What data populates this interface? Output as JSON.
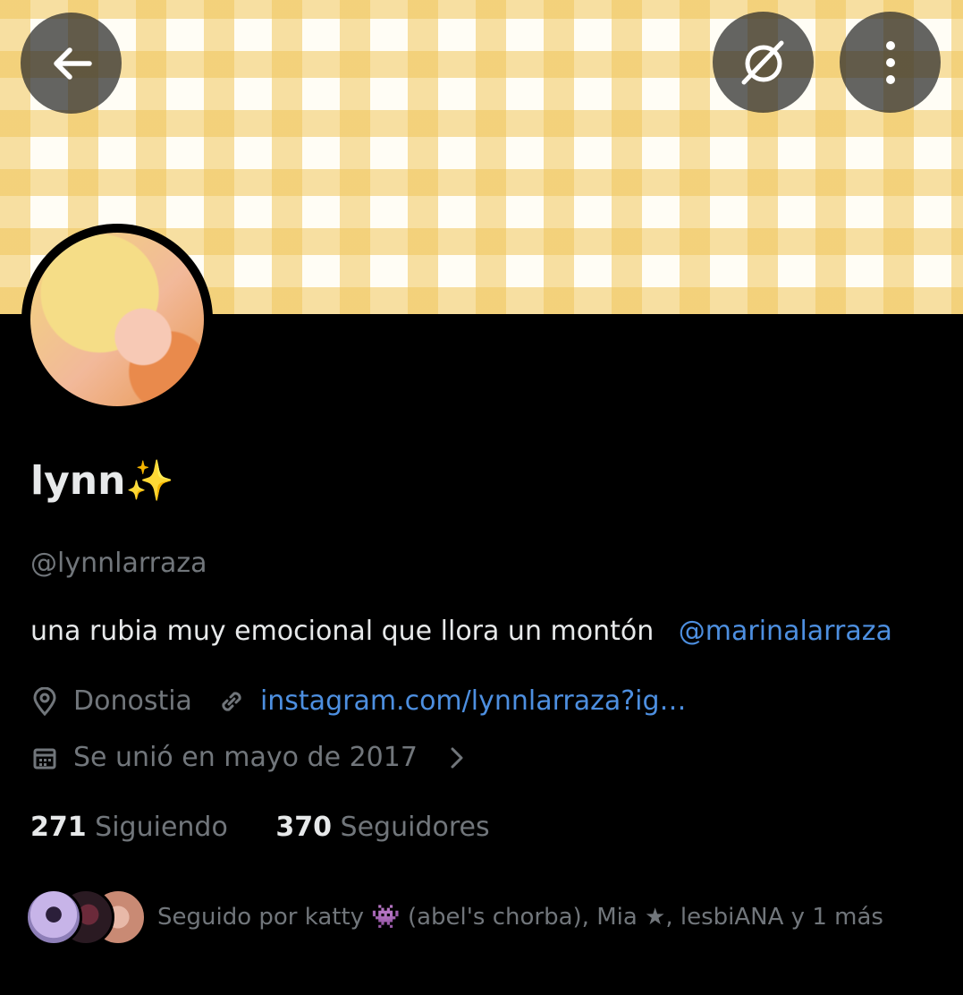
{
  "profile": {
    "display_name": "lynn✨",
    "handle": "@lynnlarraza",
    "bio_text": "una rubia muy emocional que llora un montón",
    "bio_mention": "@marinalarraza",
    "location": "Donostia",
    "website": "instagram.com/lynnlarraza?ig…",
    "joined": "Se unió en mayo de 2017"
  },
  "stats": {
    "following_count": "271",
    "following_label": "Siguiendo",
    "followers_count": "370",
    "followers_label": "Seguidores"
  },
  "followed_by": {
    "text": "Seguido por katty 👾 (abel's chorba), Mia ★, lesbiANA y 1 más"
  },
  "icons": {
    "back": "arrow-left-icon",
    "grok": "grok-icon",
    "more": "more-vertical-icon",
    "location": "location-pin-icon",
    "link": "link-icon",
    "calendar": "calendar-icon",
    "chevron": "chevron-right-icon"
  },
  "colors": {
    "background": "#000000",
    "link": "#4d8fe0",
    "secondary_text": "#71767b",
    "primary_text": "#e7e9ea",
    "banner_gingham": "#f0c65c"
  }
}
